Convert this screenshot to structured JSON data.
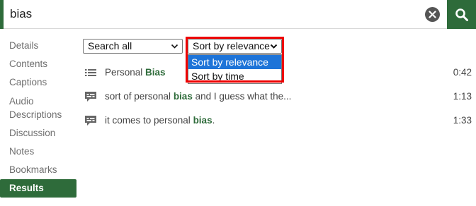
{
  "search": {
    "value": "bias",
    "placeholder": ""
  },
  "icons": {
    "clear": "close-circle-icon",
    "search": "magnifier-icon",
    "chapter": "list-icon",
    "caption": "caption-bubble-icon"
  },
  "sidebar": {
    "items": [
      {
        "label": "Details"
      },
      {
        "label": "Contents"
      },
      {
        "label": "Captions"
      },
      {
        "label": "Audio Descriptions"
      },
      {
        "label": "Discussion"
      },
      {
        "label": "Notes"
      },
      {
        "label": "Bookmarks"
      },
      {
        "label": "Results"
      }
    ],
    "active": "Results"
  },
  "filters": {
    "scope_selected": "Search all",
    "sort_selected": "Sort by relevance",
    "sort_options": [
      "Sort by relevance",
      "Sort by time"
    ]
  },
  "results": [
    {
      "type": "chapter",
      "before": "Personal ",
      "match": "Bias",
      "after": "",
      "time": "0:42"
    },
    {
      "type": "caption",
      "before": "sort of personal ",
      "match": "bias",
      "after": " and I guess what the...",
      "time": "1:13"
    },
    {
      "type": "caption",
      "before": "it comes to personal ",
      "match": "bias",
      "after": ".",
      "time": "1:33"
    }
  ],
  "colors": {
    "accent": "#2e6b3a",
    "highlight_box": "#ee0000",
    "selected_option": "#1e74d8"
  }
}
